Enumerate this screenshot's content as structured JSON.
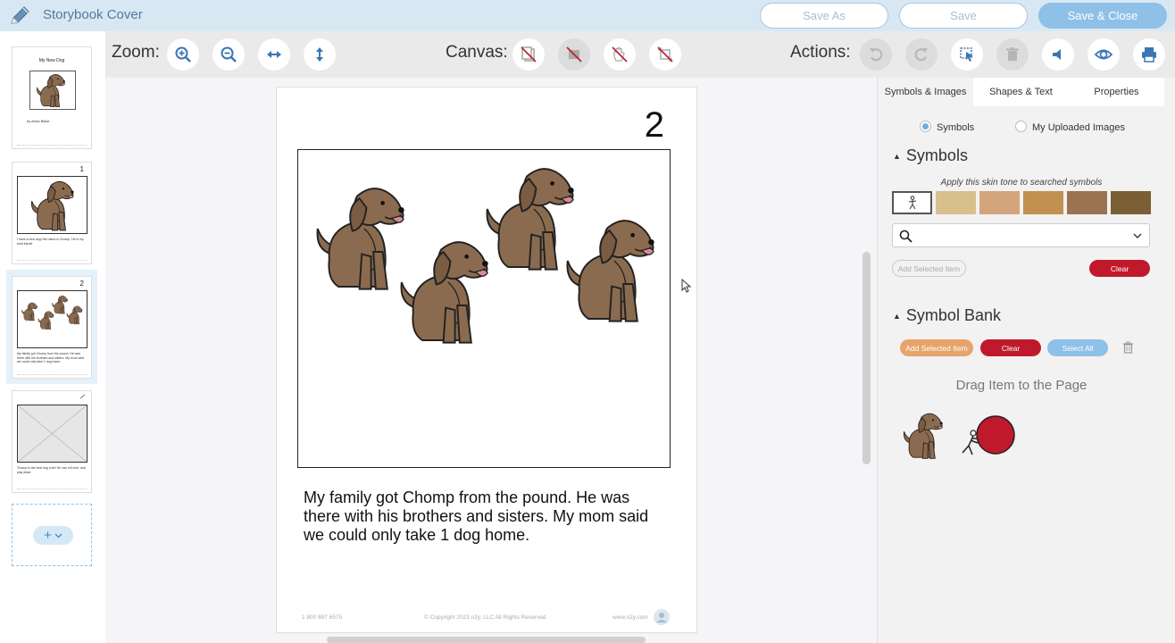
{
  "header": {
    "title": "Storybook Cover",
    "save_as": "Save As",
    "save": "Save",
    "save_close": "Save & Close"
  },
  "thumbnails": {
    "cover_title": "My New Dog",
    "cover_author": "by Anna Black",
    "page1_num": "1",
    "page1_text": "I have a new dog! His name is Chomp. He is my best friend!",
    "page2_num": "2",
    "page2_text": "My family got Chomp from the pound. He was there with his brothers and sisters. My mom said we could only take 1 dog home.",
    "page3_text": "Chomp is the best dog ever! He can roll over, and play dead.",
    "add_symbol": "+"
  },
  "toolbar": {
    "zoom_label": "Zoom:",
    "canvas_label": "Canvas:",
    "actions_label": "Actions:"
  },
  "page": {
    "number": "2",
    "text": "My family got Chomp from the pound. He was there with his brothers and sisters. My mom said we could only take 1 dog home.",
    "footer_phone": "1 800 697 6575",
    "footer_copyright": "© Copyright 2023 n2y, LLC All Rights Reserved",
    "footer_url": "www.n2y.com"
  },
  "right_panel": {
    "tabs": [
      "Symbols & Images",
      "Shapes & Text",
      "Properties"
    ],
    "radio_symbols": "Symbols",
    "radio_uploaded": "My Uploaded Images",
    "symbols_heading": "Symbols",
    "skin_tone_hint": "Apply this skin tone to searched symbols",
    "skin_tones": [
      "#d8c08e",
      "#d4a57d",
      "#c0914f",
      "#9a7350",
      "#7a5f35"
    ],
    "add_selected_disabled": "Add Selected Item",
    "clear": "Clear",
    "bank_heading": "Symbol Bank",
    "bank_add_selected": "Add Selected Item",
    "bank_clear": "Clear",
    "bank_select_all": "Select All",
    "drag_hint": "Drag Item to the Page"
  },
  "colors": {
    "header_bg": "#d8e8f3",
    "accent_blue": "#8ec0e8",
    "clear_red": "#c0192c",
    "add_orange": "#e8a36a",
    "dog_brown": "#8b6b4f"
  }
}
